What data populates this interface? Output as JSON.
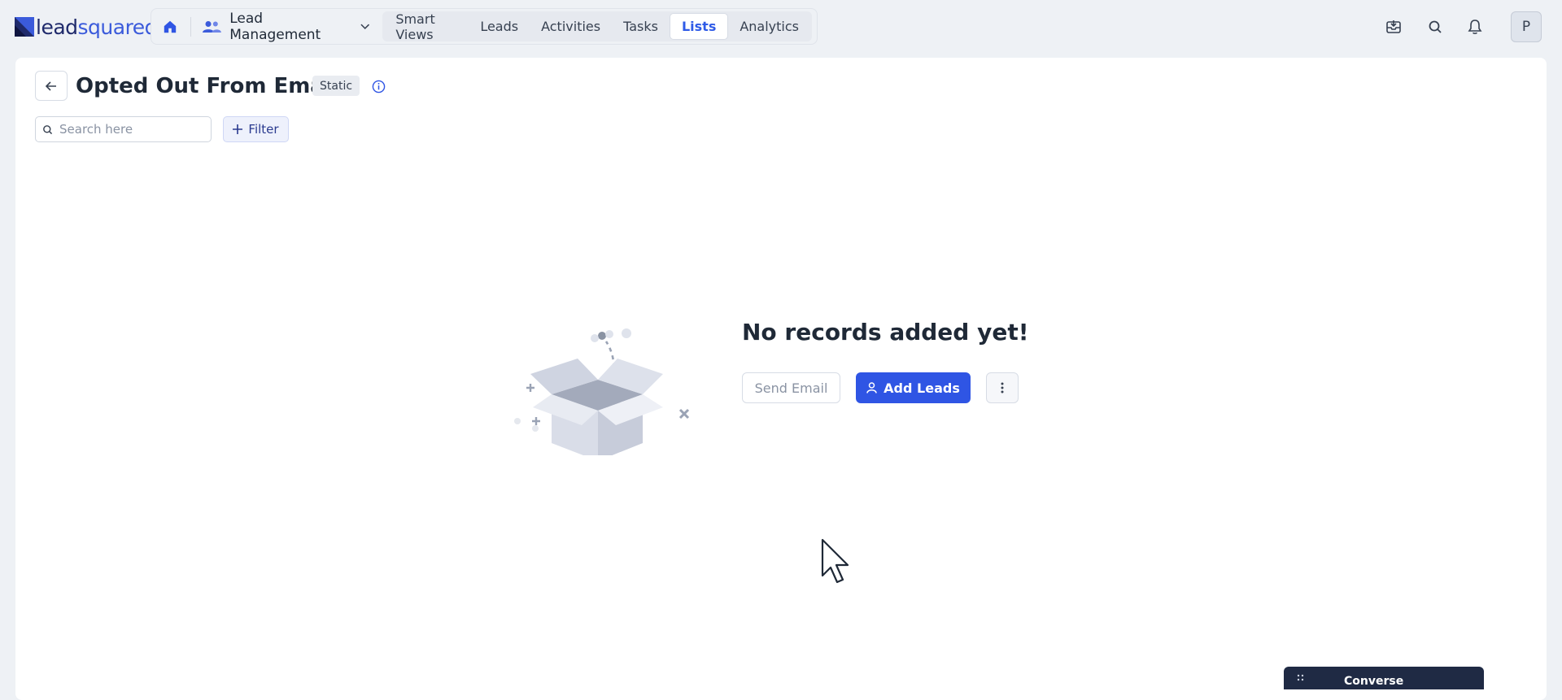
{
  "app": {
    "logo": {
      "part1": "lead",
      "part2": "squared"
    }
  },
  "nav": {
    "module": "Lead Management",
    "links": [
      {
        "label": "Smart Views",
        "active": false
      },
      {
        "label": "Leads",
        "active": false
      },
      {
        "label": "Activities",
        "active": false
      },
      {
        "label": "Tasks",
        "active": false
      },
      {
        "label": "Lists",
        "active": true
      },
      {
        "label": "Analytics",
        "active": false
      }
    ],
    "icons": [
      "home-icon",
      "users-icon",
      "chevron-down-icon",
      "inbox-icon",
      "search-icon",
      "bell-icon"
    ]
  },
  "user": {
    "avatar_initial": "P"
  },
  "page": {
    "title": "Opted Out From Email",
    "badge": "Static",
    "search_placeholder": "Search here",
    "filter_label": "Filter"
  },
  "empty_state": {
    "title": "No records added yet!",
    "send_email_label": "Send Email",
    "add_leads_label": "Add Leads"
  },
  "converse": {
    "label": "Converse"
  },
  "colors": {
    "primary": "#2f55e4",
    "background": "#eef1f5",
    "converse_bar": "#1f2a44"
  }
}
